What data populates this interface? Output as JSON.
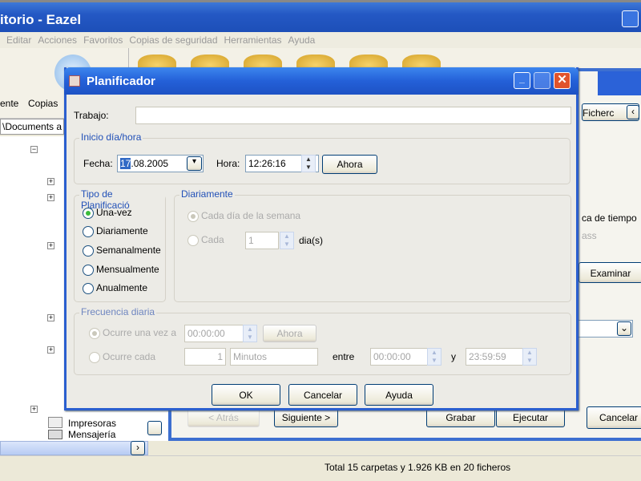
{
  "app": {
    "title": "itorio - Eazel",
    "menu": [
      "Editar",
      "Acciones",
      "Favoritos",
      "Copias de seguridad",
      "Herramientas",
      "Ayuda"
    ],
    "toolbar": [
      "ente",
      "Copias"
    ],
    "address": "\\Documents a",
    "tree": [
      "Impresoras",
      "Mensajería"
    ],
    "right": {
      "tab": "Ficherc",
      "label1": "ca de tiempo",
      "label2": "ass",
      "examinar": "Examinar",
      "atras": "< Atrás",
      "siguiente": "Siguiente >",
      "grabar": "Grabar",
      "ejecutar": "Ejecutar",
      "cancelar": "Cancelar"
    },
    "status": "Total 15 carpetas y 1.926 KB en 20 ficheros"
  },
  "dialog": {
    "title": "Planificador",
    "trabajo_label": "Trabajo:",
    "trabajo_value": "",
    "inicio": {
      "legend": "Inicio día/hora",
      "fecha_label": "Fecha:",
      "fecha_sel": "17",
      "fecha_rest": ".08.2005",
      "hora_label": "Hora:",
      "hora": "12:26:16",
      "ahora": "Ahora"
    },
    "tipo": {
      "legend": "Tipo de Planificació",
      "options": [
        "Una-vez",
        "Diariamente",
        "Semanalmente",
        "Mensualmente",
        "Anualmente"
      ],
      "selected": "Una-vez"
    },
    "diariamente": {
      "legend": "Diariamente",
      "cada_dia": "Cada día de la semana",
      "cada": "Cada",
      "cada_value": "1",
      "dias": "dia(s)"
    },
    "frecuencia": {
      "legend": "Frecuencia diaria",
      "ocurre_una": "Ocurre una vez a",
      "hora_una": "00:00:00",
      "ahora": "Ahora",
      "ocurre_cada": "Ocurre cada",
      "cada_value": "1",
      "unidad": "Minutos",
      "entre": "entre",
      "desde": "00:00:00",
      "y": "y",
      "hasta": "23:59:59"
    },
    "buttons": {
      "ok": "OK",
      "cancelar": "Cancelar",
      "ayuda": "Ayuda"
    }
  }
}
